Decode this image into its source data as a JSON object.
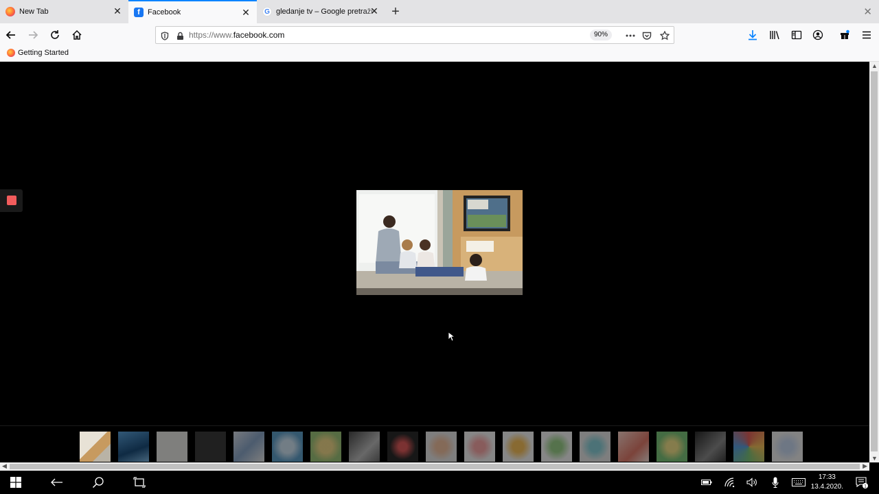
{
  "tabs": [
    {
      "title": "New Tab",
      "favicon": "firefox-icon"
    },
    {
      "title": "Facebook",
      "favicon": "facebook-icon",
      "active": true
    },
    {
      "title": "gledanje tv – Google pretraži",
      "favicon": "google-icon"
    }
  ],
  "tab_close_glyph": "✕",
  "new_tab_glyph": "+",
  "window_close_glyph": "✕",
  "nav": {
    "url_prefix": "https://www.",
    "url_domain": "facebook.com",
    "zoom": "90%"
  },
  "bookmarks": [
    {
      "label": "Getting Started"
    }
  ],
  "colors": {
    "accent": "#0a84ff",
    "viewer_bg": "#000000",
    "handle_red": "#f25c5c",
    "facebook_blue": "#1877f2"
  },
  "thumbnails_count": 19,
  "taskbar": {
    "time": "17:33",
    "date": "13.4.2020.",
    "notification_count": "1"
  }
}
